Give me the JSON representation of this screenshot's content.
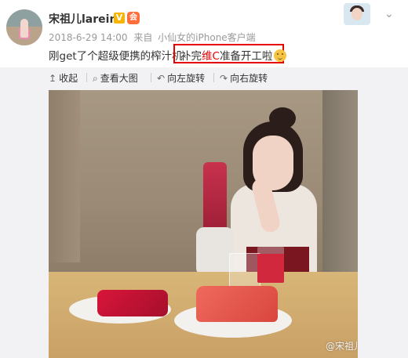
{
  "post": {
    "author_name": "宋祖儿lareina",
    "verified_badge": "V",
    "level_badge": "会",
    "timestamp": "2018-6-29 14:00",
    "source_prefix": "来自",
    "source": "小仙女的iPhone客户端",
    "text": "刚get了个超级便携的榨汁机",
    "highlight_pre": "补完",
    "highlight_red": "维C",
    "highlight_post": "准备开工啦",
    "emoji_icon": "smile-emoji-icon"
  },
  "toolbar": {
    "collapse_label": "收起",
    "view_large_label": "查看大图",
    "rotate_left_label": "向左旋转",
    "rotate_right_label": "向右旋转",
    "collapse_icon": "↥",
    "view_large_icon": "⌕",
    "rotate_left_icon": "↶",
    "rotate_right_icon": "↷"
  },
  "photo": {
    "watermark": "@宋祖儿lareina"
  },
  "header": {
    "chevron": "⌄"
  },
  "colors": {
    "highlight_border": "#e60000",
    "highlight_text": "#e60000",
    "meta_text": "#999999",
    "media_background": "#f2f2f5"
  }
}
